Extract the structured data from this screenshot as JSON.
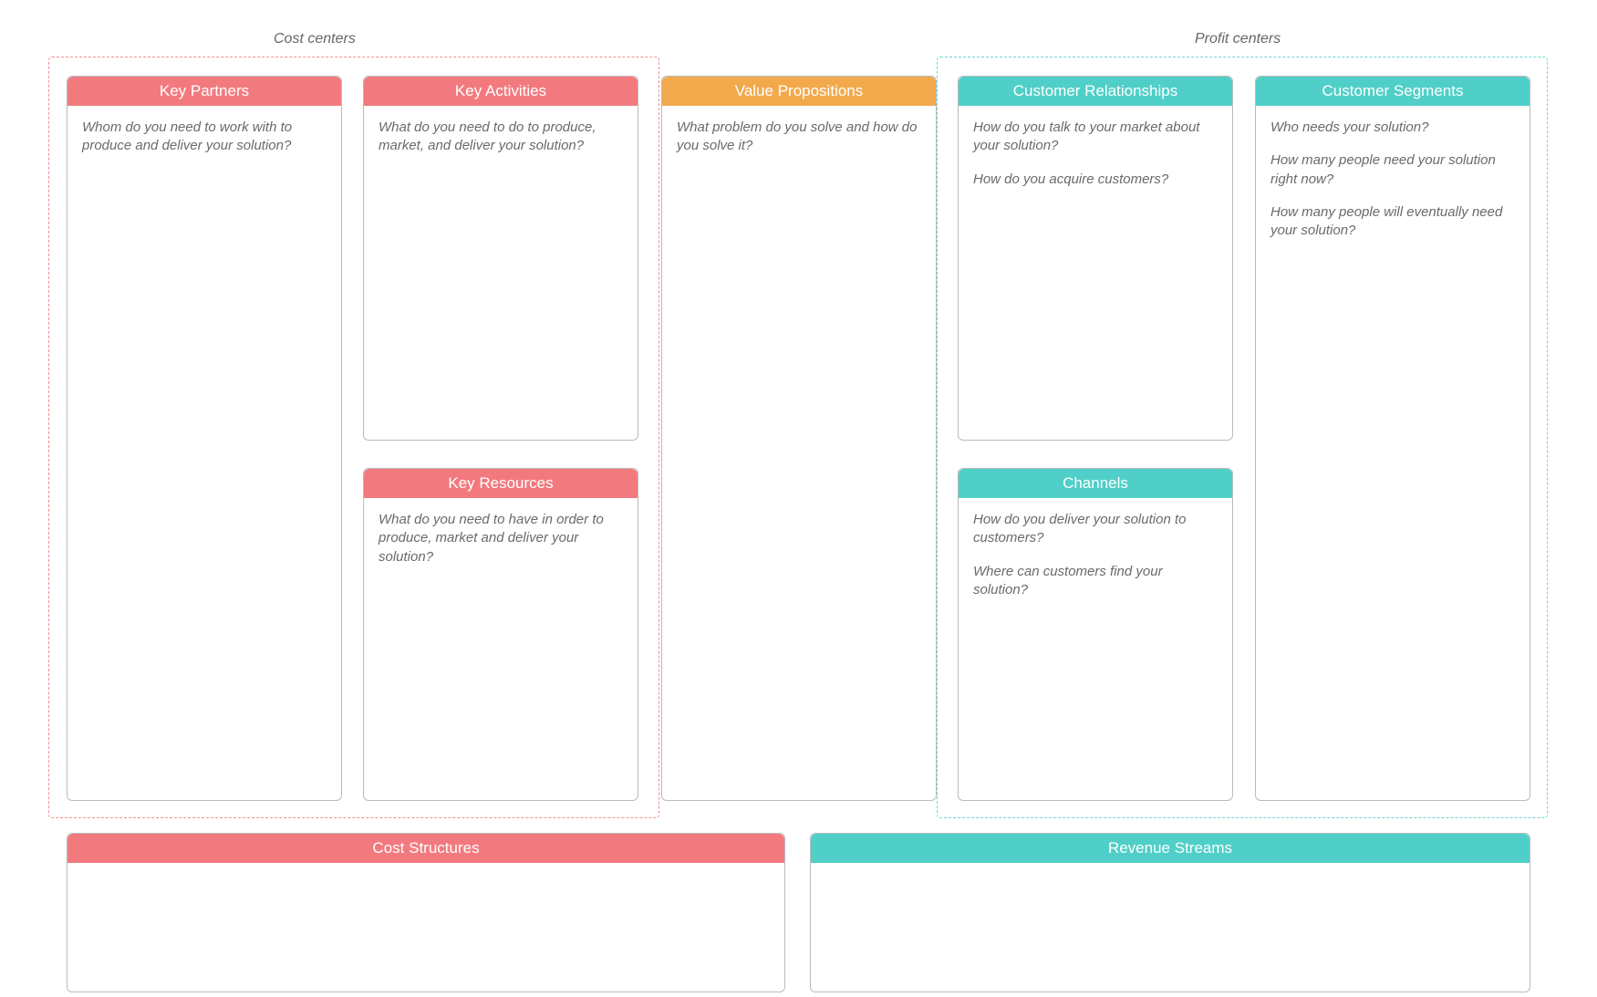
{
  "sections": {
    "cost": {
      "label": "Cost centers"
    },
    "profit": {
      "label": "Profit centers"
    }
  },
  "cards": {
    "key_partners": {
      "title": "Key Partners",
      "q1": "Whom do you need to work with to produce and deliver your solution?"
    },
    "key_activities": {
      "title": "Key Activities",
      "q1": "What do you need to do to produce, market, and deliver your solution?"
    },
    "key_resources": {
      "title": "Key Resources",
      "q1": "What do you need to have in order to produce, market and deliver your solution?"
    },
    "value_propositions": {
      "title": "Value Propositions",
      "q1": "What problem do you solve and how do you solve it?"
    },
    "customer_relationships": {
      "title": "Customer Relationships",
      "q1": "How do you talk to your market about your solution?",
      "q2": "How do you acquire customers?"
    },
    "channels": {
      "title": "Channels",
      "q1": "How do you deliver your solution to customers?",
      "q2": "Where can customers find your solution?"
    },
    "customer_segments": {
      "title": "Customer Segments",
      "q1": "Who needs your solution?",
      "q2": "How many people need your solution right now?",
      "q3": "How many people will eventually need your solution?"
    },
    "cost_structures": {
      "title": "Cost Structures"
    },
    "revenue_streams": {
      "title": "Revenue Streams"
    }
  }
}
